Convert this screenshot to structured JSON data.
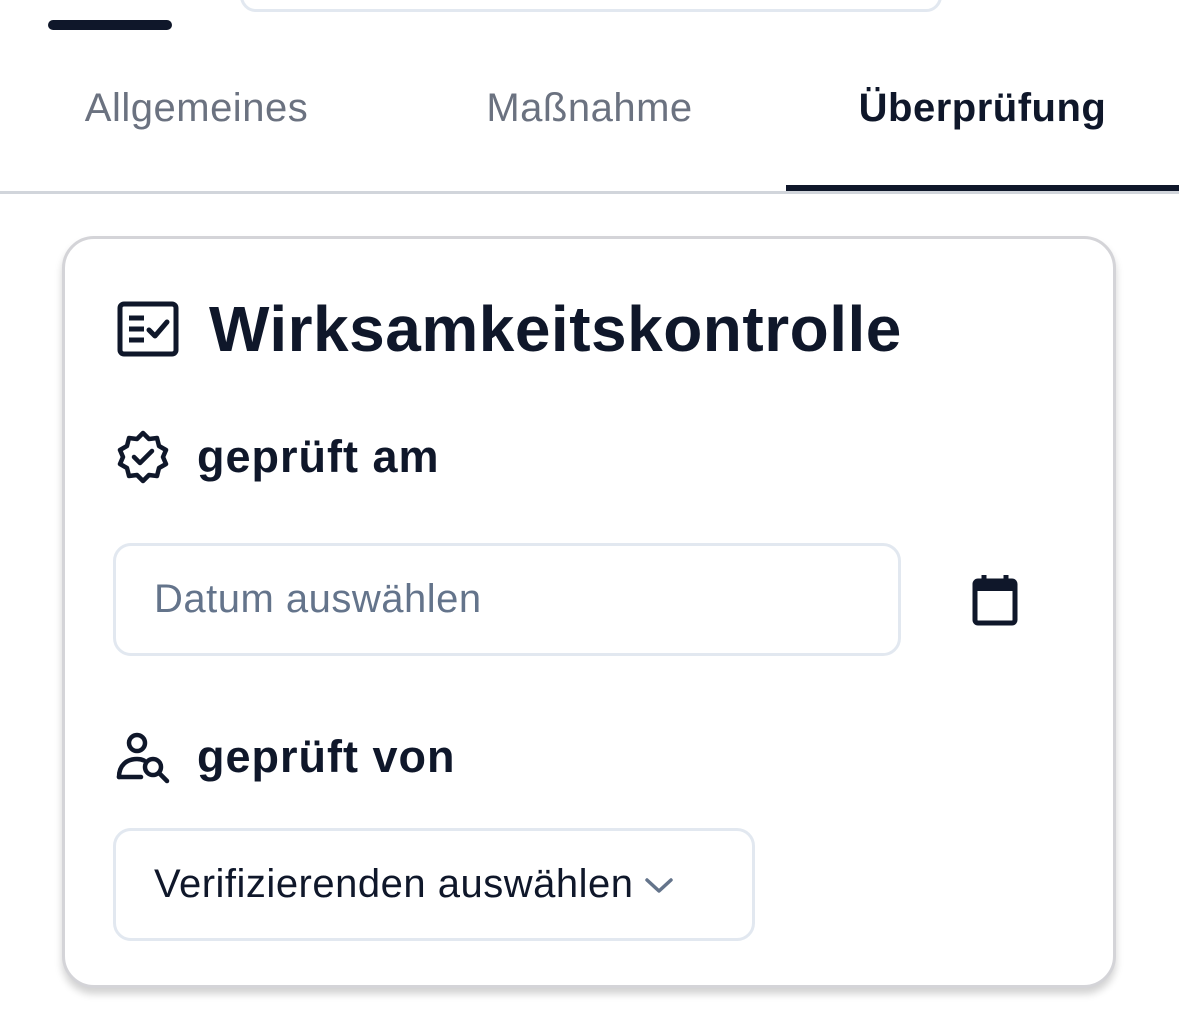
{
  "tabs": [
    {
      "label": "Allgemeines",
      "active": false
    },
    {
      "label": "Maßnahme",
      "active": false
    },
    {
      "label": "Überprüfung",
      "active": true
    }
  ],
  "card": {
    "title": "Wirksamkeitskontrolle",
    "title_icon": "checklist-icon",
    "date_field": {
      "label": "geprüft am",
      "icon": "verified-badge-icon",
      "placeholder": "Datum auswählen",
      "value": "",
      "picker_icon": "calendar-icon"
    },
    "verifier_field": {
      "label": "geprüft von",
      "icon": "person-search-icon",
      "selected": "Verifizierenden auswählen",
      "dropdown_icon": "chevron-down-icon"
    }
  },
  "colors": {
    "text_primary": "#0f172a",
    "text_muted": "#6b7280",
    "placeholder": "#64748b",
    "border": "#e2e8f0",
    "tab_divider": "#d1d5db"
  }
}
